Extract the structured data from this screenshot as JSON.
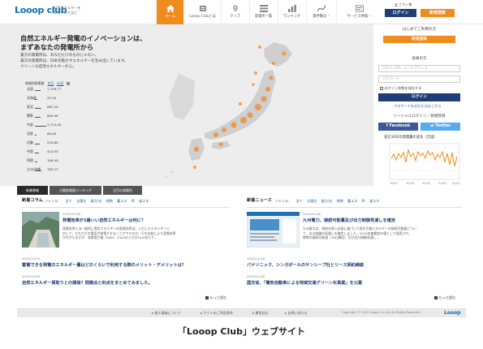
{
  "header": {
    "logo_text": "Looop club",
    "tagline_1": "自然エネルギーを",
    "tagline_2": "あなたのそばに",
    "nav": [
      {
        "label": "ホーム",
        "icon": "home-icon"
      },
      {
        "label": "Looop Clubとは",
        "icon": "info-icon"
      },
      {
        "label": "マップ",
        "icon": "map-icon"
      },
      {
        "label": "発電所一覧",
        "icon": "list-icon"
      },
      {
        "label": "ランキング",
        "icon": "ranking-icon"
      },
      {
        "label": "業界動向・",
        "icon": "trend-icon"
      }
    ],
    "service_label": "サービス情報・",
    "guest_label": "ゲスト様",
    "login_label": "ログイン",
    "register_label": "新規登録"
  },
  "hero": {
    "title_1": "自然エネルギー発電のイノベーションは、",
    "title_2": "まずあなたの発電所から",
    "desc_1": "貴方の発電所は、あなただけのものじゃない。",
    "desc_2": "貴方の発電所は、日本を動かすエネルギーを生み出しています。",
    "desc_3": "クリーンな自然エネルギーから。",
    "stats_label": "地域別発電量",
    "stats_tabs": [
      "本日",
      "30日"
    ],
    "regions": [
      {
        "name": "全国",
        "value": "7,139.77"
      },
      {
        "name": "北海道",
        "value": "25.10"
      },
      {
        "name": "東北",
        "value": "667.20"
      },
      {
        "name": "関東",
        "value": "609.46"
      },
      {
        "name": "中部",
        "value": "2,174.40"
      },
      {
        "name": "北陸",
        "value": "60.00"
      },
      {
        "name": "近畿",
        "value": "530.80"
      },
      {
        "name": "中国",
        "value": "410.50"
      },
      {
        "name": "四国",
        "value": "104.40"
      },
      {
        "name": "九州/沖縄",
        "value": "782.27"
      }
    ],
    "map_stat_box": "1,104,15"
  },
  "tabs": [
    "新着情報",
    "日間発電量ランキング",
    "注目の発電所"
  ],
  "sidebar": {
    "first_time": "はじめてご利用の方",
    "register_label": "新規登録",
    "member_label": "会員の方",
    "login_placeholder": "ログインID / メールアドレス",
    "password_placeholder": "パスワード",
    "remember_label": "ログイン状態を保存する",
    "login_label": "ログイン",
    "forgot_label": "パスワードを忘れた方はこちら",
    "social_label": "ソーシャルログイン・新規登録",
    "facebook_label": "f Facebook",
    "twitter_label": "Twitter",
    "chart_title": "直近30日の発電量の変化（全国）",
    "chart_x": [
      "10/17",
      "10/24",
      "10/31",
      "11/07",
      "11/13"
    ]
  },
  "columns": {
    "title": "新着コラム",
    "genre_label": "ジャンル：",
    "genres": [
      "全て",
      "太陽光",
      "風力/水",
      "地熱",
      "蓄エネ",
      "IR",
      "省エネ",
      "海外"
    ],
    "articles": [
      {
        "date": "2015/11/18",
        "title": "発電効率が1番いい自然エネルギーは何に？",
        "body_1": "発電効率とは一般的に電気エネルギーの変換効率は、入力したエネルギーに",
        "body_2": "対して、どれだけの電気が発電させることができるか、その比較により変換効率",
        "body_3": "が分かりますが、発電電力量（kWh）/1m2の入力が1m2あたり..."
      },
      {
        "date": "2015/11/13",
        "title": "蓄電できる発電のエネルギー量はどのくらいで利用する際のメリット・デメリットは？"
      },
      {
        "date": "2015/11/16",
        "title": "自然エネルギー買取りとの関係？問題点と利点をまとめてみました。"
      }
    ],
    "more": "もっと読む"
  },
  "news": {
    "title": "新着ニュース",
    "genre_label": "ジャンル：",
    "genres": [
      "全て",
      "太陽光",
      "風力/水",
      "地熱",
      "蓄エネ",
      "IR",
      "省エネ",
      "海外"
    ],
    "articles": [
      {
        "date": "2015/11/18",
        "title": "九州電力、接続可能量及び出力制御見通しを確定",
        "body_1": "九州電力は、政府の導入計画に基づいて再生可能エネルギーの接続可能量につい",
        "body_2": "て、出力制御の見通しを確定しました。2015年度算定の値として発表され、",
        "body_3": "毎時の接続可能量（30日算出）及び出力制御見通し..."
      },
      {
        "date": "2015/11/18",
        "title": "パナソニック、シンガポールのサンシープ社とリース契約締結"
      },
      {
        "date": "2015/11/18",
        "title": "国交省、「電気自動車による地域交通グリーン化事業」を公募"
      }
    ],
    "more": "もっと読む"
  },
  "footer": {
    "links": [
      "個人情報について",
      "サイトのご利用条件",
      "運営会社",
      "お問い合わせ"
    ],
    "copyright": "Copyright © 2015 Looop Co.,Ltd All Rights Reserved.",
    "logo": "Looop"
  },
  "caption": "「Looop Club」ウェブサイト",
  "colors": {
    "accent": "#f08c1e",
    "navy": "#1f3e75",
    "brand": "#0a70b8"
  }
}
